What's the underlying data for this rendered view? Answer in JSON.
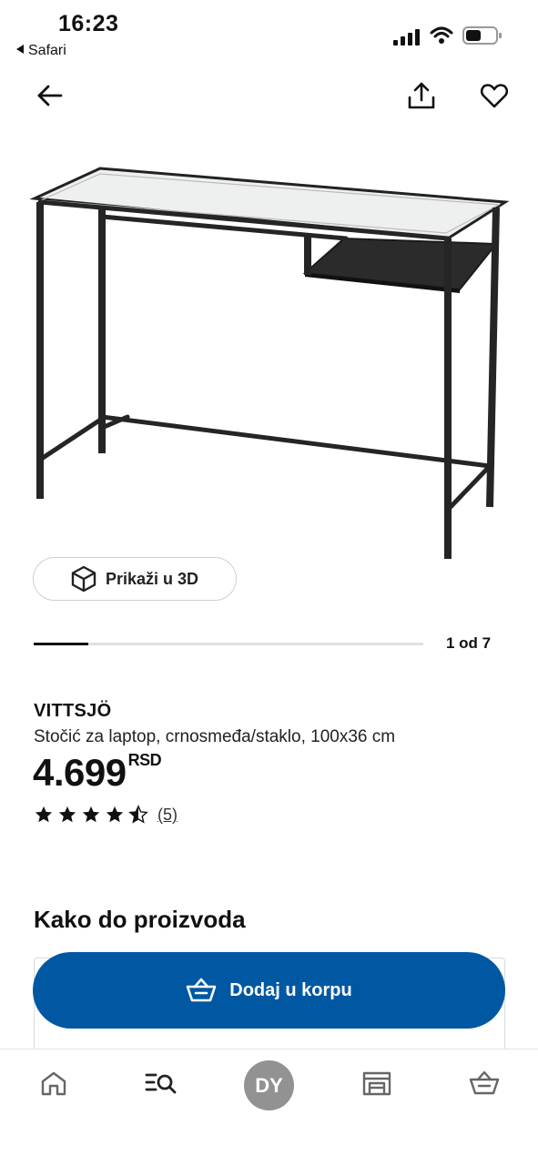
{
  "status_bar": {
    "time": "16:23",
    "back_app": "Safari"
  },
  "product": {
    "name": "VITTSJÖ",
    "description": "Stočić za laptop, crnosmeđa/staklo, 100x36 cm",
    "price": "4.699",
    "currency": "RSD",
    "rating": 4.5,
    "review_count": "(5)"
  },
  "gallery": {
    "view_3d_label": "Prikaži u 3D",
    "pager": "1 od 7",
    "progress": 0.14
  },
  "section": {
    "title": "Kako do proizvoda"
  },
  "cart": {
    "label": "Dodaj u korpu"
  },
  "tabbar": {
    "avatar_initials": "DY"
  },
  "colors": {
    "primary": "#0058a3",
    "avatar": "#929292"
  }
}
